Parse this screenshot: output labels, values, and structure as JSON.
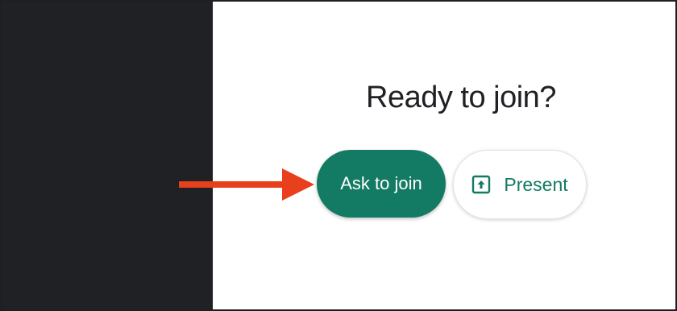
{
  "join_panel": {
    "title": "Ready to join?",
    "ask_to_join_label": "Ask to join",
    "present_label": "Present",
    "present_icon": "present-screen-icon"
  },
  "annotation": {
    "arrow_icon": "arrow-right-icon",
    "arrow_color": "#e8401c"
  },
  "colors": {
    "accent": "#137a63",
    "video_background": "#202124",
    "panel_background": "#ffffff"
  }
}
